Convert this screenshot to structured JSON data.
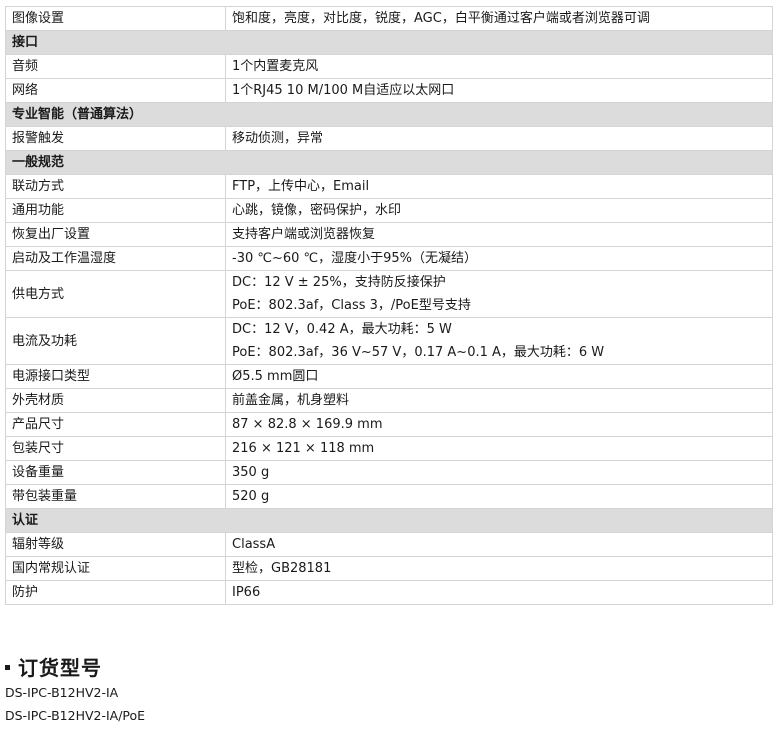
{
  "rows": [
    {
      "type": "row",
      "label": "图像设置",
      "values": [
        "饱和度，亮度，对比度，锐度，AGC，白平衡通过客户端或者浏览器可调"
      ]
    },
    {
      "type": "section",
      "label": "接口"
    },
    {
      "type": "row",
      "label": "音频",
      "values": [
        "1个内置麦克风"
      ]
    },
    {
      "type": "row",
      "label": "网络",
      "values": [
        "1个RJ45 10 M/100 M自适应以太网口"
      ]
    },
    {
      "type": "section",
      "label": "专业智能（普通算法）"
    },
    {
      "type": "row",
      "label": "报警触发",
      "values": [
        "移动侦测，异常"
      ]
    },
    {
      "type": "section",
      "label": "一般规范"
    },
    {
      "type": "row",
      "label": "联动方式",
      "values": [
        "FTP，上传中心，Email"
      ]
    },
    {
      "type": "row",
      "label": "通用功能",
      "values": [
        "心跳，镜像，密码保护，水印"
      ]
    },
    {
      "type": "row",
      "label": "恢复出厂设置",
      "values": [
        "支持客户端或浏览器恢复"
      ]
    },
    {
      "type": "row",
      "label": "启动及工作温湿度",
      "values": [
        "-30 ℃~60 ℃，湿度小于95%（无凝结）"
      ]
    },
    {
      "type": "row",
      "label": "供电方式",
      "values": [
        "DC：12 V ± 25%，支持防反接保护",
        "PoE：802.3af，Class 3，/PoE型号支持"
      ]
    },
    {
      "type": "row",
      "label": "电流及功耗",
      "values": [
        "DC：12 V，0.42 A，最大功耗：5 W",
        "PoE：802.3af，36 V~57 V，0.17 A~0.1 A，最大功耗：6 W"
      ]
    },
    {
      "type": "row",
      "label": "电源接口类型",
      "values": [
        "Ø5.5 mm圆口"
      ]
    },
    {
      "type": "row",
      "label": "外壳材质",
      "values": [
        "前盖金属，机身塑料"
      ]
    },
    {
      "type": "row",
      "label": "产品尺寸",
      "values": [
        "87 × 82.8 × 169.9 mm"
      ]
    },
    {
      "type": "row",
      "label": "包装尺寸",
      "values": [
        "216 × 121 × 118 mm"
      ]
    },
    {
      "type": "row",
      "label": "设备重量",
      "values": [
        "350 g"
      ]
    },
    {
      "type": "row",
      "label": "带包装重量",
      "values": [
        "520 g"
      ]
    },
    {
      "type": "section",
      "label": "认证"
    },
    {
      "type": "row",
      "label": "辐射等级",
      "values": [
        "ClassA"
      ]
    },
    {
      "type": "row",
      "label": "国内常规认证",
      "values": [
        "型检，GB28181"
      ]
    },
    {
      "type": "row",
      "label": "防护",
      "values": [
        "IP66"
      ]
    }
  ],
  "order": {
    "title": "订货型号",
    "models": [
      "DS-IPC-B12HV2-IA",
      "DS-IPC-B12HV2-IA/PoE"
    ]
  }
}
